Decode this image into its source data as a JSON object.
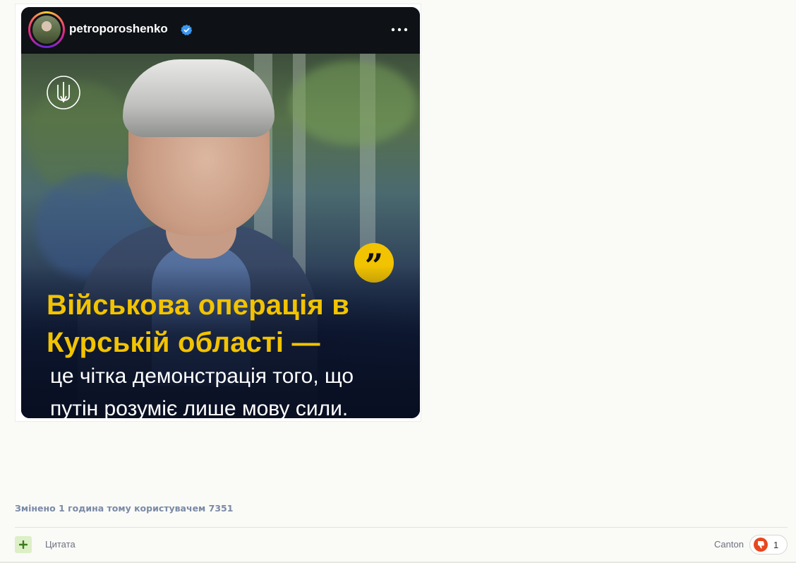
{
  "post": {
    "username": "petroporoshenko",
    "verified_icon": "verified-badge-icon",
    "more_icon": "more-options-icon",
    "image": {
      "emblem_icon": "trident-icon",
      "quote_icon": "quote-mark-icon",
      "quote_mark": "”",
      "headline_line1": "Військова операція в",
      "headline_line2": "Курській області —",
      "subline_line1": "це чітка демонстрація того, що",
      "subline_line2": "путін розуміє лише мову сили."
    }
  },
  "footer": {
    "edited_note": "Змінено 1 година тому користувачем 7351",
    "plus_label": "+",
    "quote_label": "Цитата",
    "author": "Canton",
    "reaction_icon": "thumbs-down-icon",
    "reaction_count": "1"
  },
  "colors": {
    "headline": "#f2c300",
    "verified": "#3897f0",
    "reaction": "#e8471e",
    "plus_bg": "#dcefc6"
  }
}
